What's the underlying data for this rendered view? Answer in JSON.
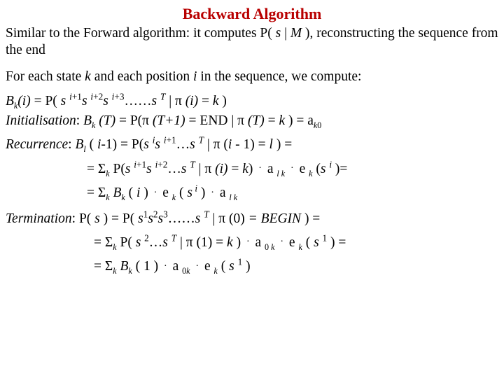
{
  "title": "Backward Algorithm",
  "intro": {
    "prefix": "Similar to the Forward algorithm: it computes P( ",
    "s": "s",
    "mid": " | ",
    "M": "M",
    "suffix": " ), reconstructing the sequence from the end"
  },
  "foreach": {
    "a": "For each state ",
    "k": "k",
    "b": " and each position ",
    "i": "i",
    "c": " in the sequence, we compute:"
  },
  "eq_b": {
    "B": "B",
    "k": "k",
    "lpar": "(i)",
    "eq": " = P( ",
    "s": "s ",
    "ip1": "i",
    "p1": "+1",
    "ip2": "i",
    "p2": "+2",
    "ip3": "i",
    "p3": "+3",
    "dots": "……",
    "s2": "s ",
    "T": "T",
    "bar": " | ",
    "pi": "π",
    "pi_arg": " (i)",
    "eqk": " = ",
    "kk": "k",
    "close": " )"
  },
  "init": {
    "label": "Initialisation",
    "colon": ":",
    "lhs": "  B",
    "k": "k",
    "arg": " (T)",
    "eq": " = P(",
    "pi": "π",
    "Tp1": " (T+1)",
    "end": " = END | ",
    "pi2": "π",
    "T": " (T)",
    "eqk": " = ",
    "kk": "k",
    "close": " ) = a",
    "ak0_k": "k",
    "ak0_0": "0"
  },
  "rec": {
    "label": "Recurrence",
    "colon": ":",
    "lhs": "   B",
    "l": "l",
    "arg": " ( ",
    "im1": "i",
    "m1": "-1) = P(",
    "s": "s ",
    "i1": "i",
    "s2": "s ",
    "ip1i": "i",
    "ip1p": "+1",
    "dots": "…",
    "s3": "s ",
    "T": "T",
    "bar": " | ",
    "pi": "π",
    "pi_arg": " (",
    "ii": "i",
    "minus1": " - 1)",
    "eql": " = ",
    "ll": "l",
    "close": " )  ="
  },
  "rec2": {
    "eq": "= Σ",
    "sigk": "k",
    "P": " P(",
    "s": "s ",
    "ip1i": "i",
    "ip1p": "+1",
    "s2": "s ",
    "ip2i": "i",
    "ip2p": "+2",
    "dots": "…",
    "s3": "s ",
    "T": "T",
    "bar": " | ",
    "pi": "π",
    "pi_arg": " (i)",
    "eqk": " = ",
    "kk": "k",
    "close": ") ",
    "dot": "·",
    "a": " a ",
    "al": "l",
    "ak": " k",
    "dot2": "·",
    "e": " e ",
    "ek": "k",
    "lpar": " (",
    "si": "s ",
    "sii": "i",
    "rpar": " )="
  },
  "rec3": {
    "eq": "= Σ",
    "sigk": "k",
    "B": " B",
    "bk": "k",
    "arg": "  ( ",
    "i": "i",
    "arg2": " ) ",
    "dot": "·",
    "e": " e ",
    "ek": "k",
    "lpar": " ( ",
    "si": "s",
    "sii": " i",
    "rpar": " ) ",
    "dot2": "·",
    "a": " a ",
    "al": "l",
    "ak": " k"
  },
  "term": {
    "label": "Termination",
    "colon": ":",
    "lhs": "   P( ",
    "s": "s",
    "eq": " ) = P( ",
    "s1": "s",
    "e1": "1",
    "s2": "s",
    "e2": "2",
    "s3": "s",
    "e3": "3",
    "dots": "……",
    "sT": "s ",
    "T": "T",
    "bar": " | ",
    "pi": "π",
    "zero": " (0)",
    "beg": " = ",
    "BEGIN": "BEGIN",
    "close": " ) ="
  },
  "term2": {
    "eq": "= Σ",
    "sigk": "k",
    "P": " P( ",
    "s": "s ",
    "e2": "2",
    "dots": "…",
    "sT": "s ",
    "T": "T",
    "bar": " | ",
    "pi": "π",
    "one": " (1)",
    "eqk": " = ",
    "kk": "k",
    "close": " ) ",
    "dot": "·",
    "a": " a ",
    "a0": "0",
    "ak": " k",
    "dot2": "·",
    "e": " e ",
    "ek": "k",
    "lpar": " ( ",
    "si": "s ",
    "sii": "1",
    "rpar": " ) ="
  },
  "term3": {
    "eq": "= Σ",
    "sigk": "k",
    "B": " B",
    "bk": "k",
    "arg": " ( 1 ) ",
    "dot": "·",
    "a": " a ",
    "a0": "0",
    "ak": "k",
    "dot2": "·",
    "e": " e ",
    "ek": "k",
    "lpar": " ( ",
    "si": "s ",
    "sii": "1",
    "rpar": " )"
  }
}
